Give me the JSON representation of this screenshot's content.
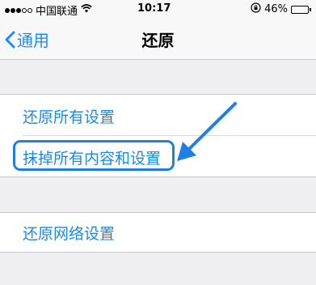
{
  "status_bar": {
    "carrier": "中国联通",
    "time": "10:17",
    "battery_percent": "46%",
    "battery_level": 0.46,
    "signal_filled": 3,
    "signal_total": 5,
    "icons": [
      "wifi-icon",
      "orientation-lock-icon",
      "battery-icon"
    ]
  },
  "nav": {
    "back_label": "通用",
    "title": "还原"
  },
  "settings": {
    "reset_all_settings": "还原所有设置",
    "erase_all": "抹掉所有内容和设置",
    "reset_network": "还原网络设置"
  },
  "colors": {
    "accent": "#1a8cff",
    "annotation": "#1e7fe6"
  }
}
